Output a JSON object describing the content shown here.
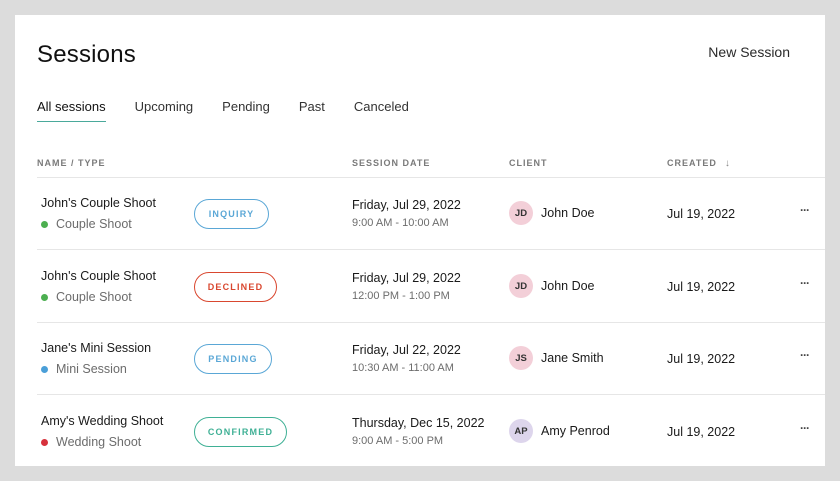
{
  "header": {
    "title": "Sessions",
    "new_session_label": "New Session"
  },
  "tabs": [
    {
      "label": "All sessions",
      "active": true
    },
    {
      "label": "Upcoming",
      "active": false
    },
    {
      "label": "Pending",
      "active": false
    },
    {
      "label": "Past",
      "active": false
    },
    {
      "label": "Canceled",
      "active": false
    }
  ],
  "table": {
    "columns": {
      "name_type": "NAME / TYPE",
      "session_date": "SESSION DATE",
      "client": "CLIENT",
      "created": "CREATED",
      "created_sort_icon": "↓"
    },
    "rows": [
      {
        "name": "John's Couple Shoot",
        "type": "Couple Shoot",
        "type_color": "#4caf50",
        "status": "INQUIRY",
        "status_color": "#5aa7d6",
        "date": "Friday, Jul 29, 2022",
        "time": "9:00 AM - 10:00 AM",
        "client_initials": "JD",
        "avatar_color": "#f3cfd8",
        "client": "John Doe",
        "created": "Jul 19, 2022",
        "more": "···"
      },
      {
        "name": "John's Couple Shoot",
        "type": "Couple Shoot",
        "type_color": "#4caf50",
        "status": "DECLINED",
        "status_color": "#d9472f",
        "date": "Friday, Jul 29, 2022",
        "time": "12:00 PM - 1:00 PM",
        "client_initials": "JD",
        "avatar_color": "#f3cfd8",
        "client": "John Doe",
        "created": "Jul 19, 2022",
        "more": "···"
      },
      {
        "name": "Jane's Mini Session",
        "type": "Mini Session",
        "type_color": "#4a9fd8",
        "status": "PENDING",
        "status_color": "#5aa7d6",
        "date": "Friday, Jul 22, 2022",
        "time": "10:30 AM - 11:00 AM",
        "client_initials": "JS",
        "avatar_color": "#f3cfd8",
        "client": "Jane Smith",
        "created": "Jul 19, 2022",
        "more": "···"
      },
      {
        "name": "Amy's Wedding Shoot",
        "type": "Wedding Shoot",
        "type_color": "#d6323c",
        "status": "CONFIRMED",
        "status_color": "#3fb095",
        "date": "Thursday, Dec 15, 2022",
        "time": "9:00 AM - 5:00 PM",
        "client_initials": "AP",
        "avatar_color": "#ddd5ec",
        "client": "Amy Penrod",
        "created": "Jul 19, 2022",
        "more": "···"
      }
    ]
  }
}
